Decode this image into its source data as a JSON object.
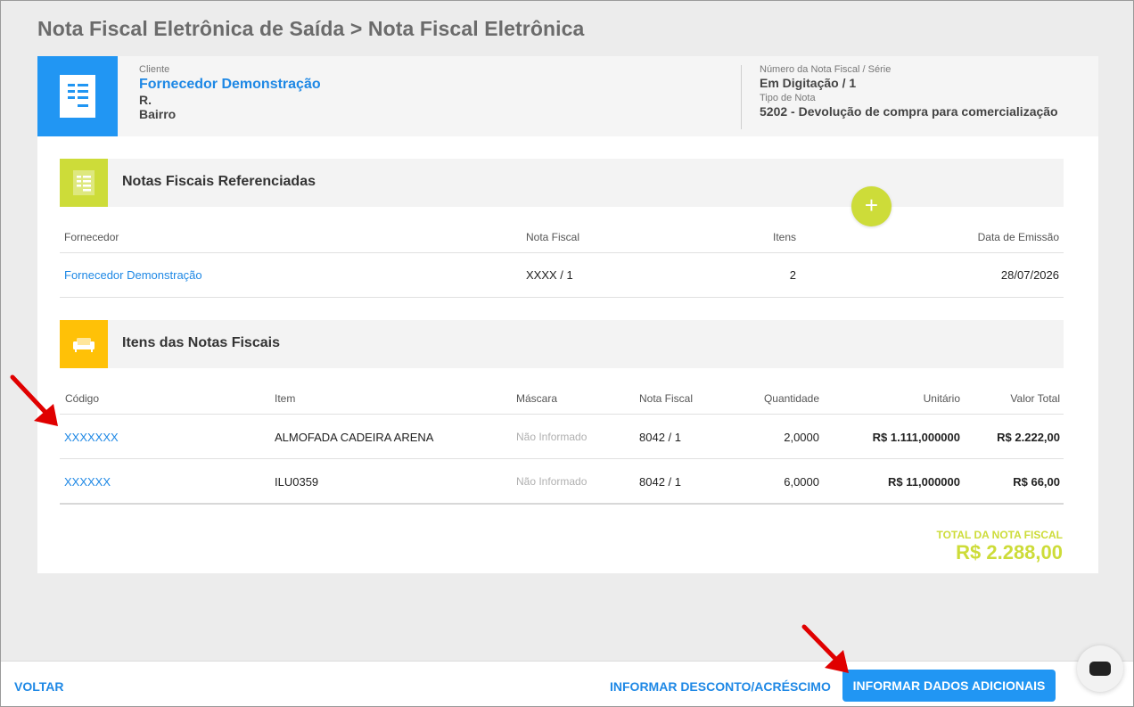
{
  "breadcrumb": "Nota Fiscal Eletrônica de Saída > Nota Fiscal Eletrônica",
  "header": {
    "client_label": "Cliente",
    "client_name": "Fornecedor Demonstração",
    "address_line1": "R.",
    "address_line2": "Bairro",
    "nf_number_label": "Número da Nota Fiscal / Série",
    "nf_number_value": "Em Digitação / 1",
    "nf_type_label": "Tipo de Nota",
    "nf_type_value": "5202 - Devolução de compra para comercialização"
  },
  "referenced": {
    "title": "Notas Fiscais Referenciadas",
    "add_glyph": "+",
    "columns": {
      "supplier": "Fornecedor",
      "nf": "Nota Fiscal",
      "items": "Itens",
      "date": "Data de Emissão"
    },
    "rows": [
      {
        "supplier": "Fornecedor Demonstração",
        "nf": "XXXX / 1",
        "items": "2",
        "date": "28/07/2026"
      }
    ]
  },
  "items_section": {
    "title": "Itens das Notas Fiscais",
    "columns": {
      "code": "Código",
      "item": "Item",
      "mask": "Máscara",
      "nf": "Nota Fiscal",
      "qty": "Quantidade",
      "unit": "Unitário",
      "total": "Valor Total"
    },
    "rows": [
      {
        "code": "XXXXXXX",
        "item": "ALMOFADA CADEIRA ARENA",
        "mask": "Não Informado",
        "nf": "8042 / 1",
        "qty": "2,0000",
        "unit": "R$ 1.111,000000",
        "total": "R$ 2.222,00"
      },
      {
        "code": "XXXXXX",
        "item": "ILU0359",
        "mask": "Não Informado",
        "nf": "8042 / 1",
        "qty": "6,0000",
        "unit": "R$ 11,000000",
        "total": "R$ 66,00"
      }
    ]
  },
  "totals": {
    "label": "TOTAL DA NOTA FISCAL",
    "value": "R$ 2.288,00"
  },
  "footer": {
    "back_label": "VOLTAR",
    "discount_label": "INFORMAR DESCONTO/ACRÉSCIMO",
    "additional_label": "INFORMAR DADOS ADICIONAIS"
  },
  "colors": {
    "primary": "#2196f3",
    "link": "#1e88e5",
    "lime": "#cddc39",
    "amber": "#ffc107",
    "annotation_red": "#e00000"
  },
  "icons": {
    "header": "invoice-document-icon",
    "referenced": "document-list-icon",
    "items": "sofa-icon",
    "chat": "chat-icon",
    "add": "plus-icon"
  }
}
